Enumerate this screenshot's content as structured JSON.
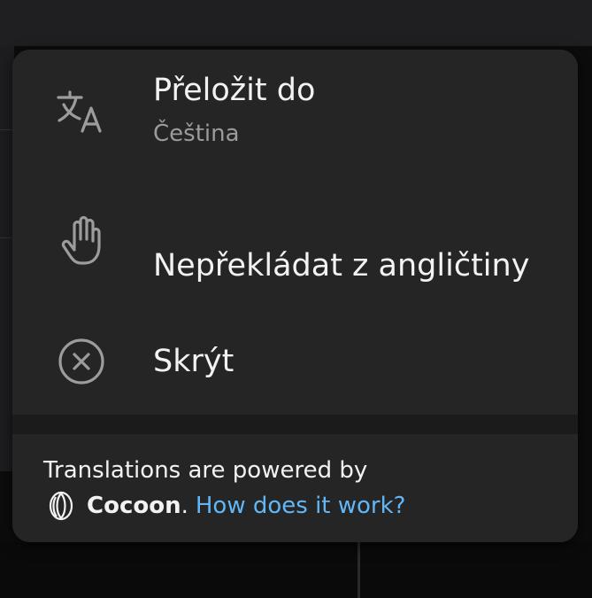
{
  "menu": {
    "translate": {
      "label": "Přeložit do",
      "sublabel": "Čeština",
      "icon": "translate-icon"
    },
    "do_not_translate": {
      "label": "Nepřekládat z angličtiny",
      "icon": "hand-icon"
    },
    "hide": {
      "label": "Skrýt",
      "icon": "close-circle-icon"
    }
  },
  "footer": {
    "line1": "Translations are powered by",
    "brand": "Cocoon",
    "separator": ".",
    "link": "How does it work?",
    "icon": "cocoon-logo-icon"
  },
  "colors": {
    "menu_bg": "#252526",
    "text": "#f2f2f2",
    "secondary_text": "#9b9b9b",
    "link": "#62b6f5"
  }
}
